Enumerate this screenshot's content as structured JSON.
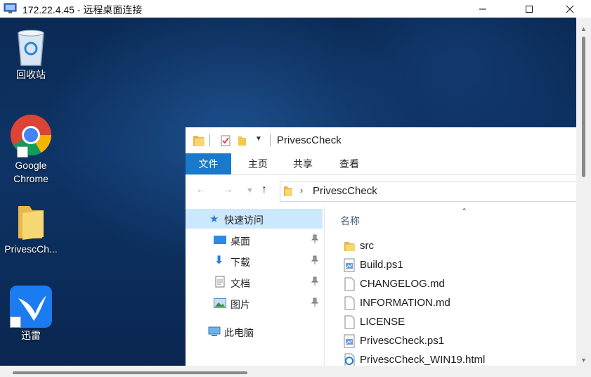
{
  "window": {
    "title": "172.22.4.45 - 远程桌面连接",
    "controls": [
      "minimize",
      "maximize",
      "close"
    ]
  },
  "desktop": {
    "icons": [
      {
        "label": "回收站",
        "icon": "recycle-bin-icon"
      },
      {
        "label": "Google Chrome",
        "icon": "chrome-icon"
      },
      {
        "label": "PrivescCh...",
        "icon": "folder-icon"
      },
      {
        "label": "迅雷",
        "icon": "xunlei-icon"
      }
    ]
  },
  "explorer": {
    "title": "PrivescCheck",
    "ribbon_tabs": [
      "文件",
      "主页",
      "共享",
      "查看"
    ],
    "address": {
      "path": "PrivescCheck"
    },
    "nav": {
      "quick_access": "快速访问",
      "items": [
        "桌面",
        "下载",
        "文档",
        "图片"
      ],
      "this_pc": "此电脑"
    },
    "content": {
      "column_name": "名称",
      "files": [
        {
          "name": "src",
          "type": "folder"
        },
        {
          "name": "Build.ps1",
          "type": "ps1"
        },
        {
          "name": "CHANGELOG.md",
          "type": "doc"
        },
        {
          "name": "INFORMATION.md",
          "type": "doc"
        },
        {
          "name": "LICENSE",
          "type": "doc"
        },
        {
          "name": "PrivescCheck.ps1",
          "type": "ps1"
        },
        {
          "name": "PrivescCheck_WIN19.html",
          "type": "html"
        }
      ]
    }
  }
}
